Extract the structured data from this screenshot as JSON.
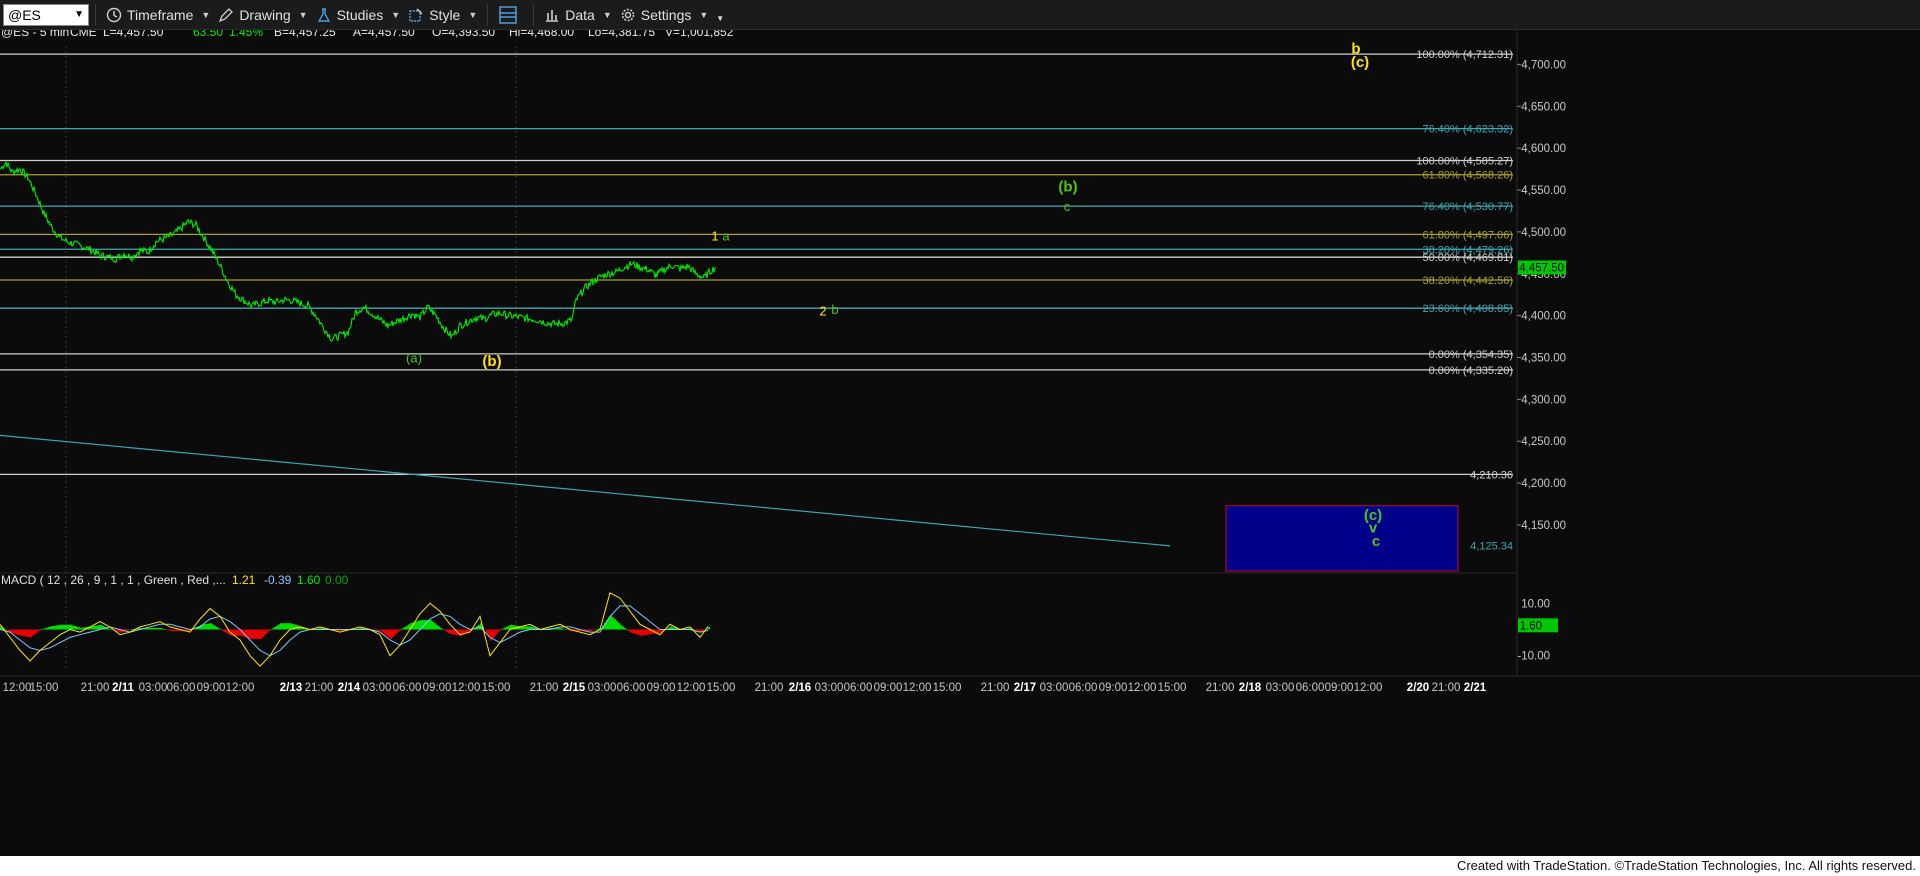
{
  "toolbar": {
    "symbol": "@ES",
    "timeframe": "Timeframe",
    "drawing": "Drawing",
    "studies": "Studies",
    "style": "Style",
    "data": "Data",
    "settings": "Settings"
  },
  "header": {
    "symbol_info": "@ES - 5 min",
    "exchange": "CME",
    "last": "L=4,457.50",
    "change": "63.50",
    "change_pct": "1.45%",
    "bid": "B=4,457.25",
    "ask": "A=4,457.50",
    "open": "O=4,393.50",
    "high": "Hi=4,468.00",
    "low": "Lo=4,381.75",
    "volume": "V=1,001,852"
  },
  "colors": {
    "price": "#00ee00",
    "bg": "#0b0b0b",
    "teal": "#3fa7b1",
    "olive": "#a8a02e",
    "white_line": "#d0d0d0",
    "yellow_label": "#ffe600",
    "green_label": "#4cc81a",
    "macd_up": "#00dd00",
    "macd_down": "#e60000",
    "box_fill": "#00008b",
    "box_border": "#cc0033"
  },
  "chart_data": {
    "type": "line",
    "title": "@ES - 5 min",
    "ylim": [
      4095,
      4722
    ],
    "price_axis_ticks": [
      "4,700.00",
      "4,650.00",
      "4,600.00",
      "4,550.00",
      "4,500.00",
      "4,450.00",
      "4,400.00",
      "4,350.00",
      "4,300.00",
      "4,250.00",
      "4,200.00",
      "4,150.00"
    ],
    "price_axis_values": [
      4700,
      4650,
      4600,
      4550,
      4500,
      4450,
      4400,
      4350,
      4300,
      4250,
      4200,
      4150
    ],
    "last_price_label": "4,457.50",
    "last_price": 4457.5,
    "time_axis": [
      "12:00",
      "15:00",
      "21:00",
      "2/11",
      "03:00",
      "06:00",
      "09:00",
      "12:00",
      "2/13",
      "21:00",
      "2/14",
      "03:00",
      "06:00",
      "09:00",
      "12:00",
      "15:00",
      "21:00",
      "2/15",
      "03:00",
      "06:00",
      "09:00",
      "12:00",
      "15:00",
      "21:00",
      "2/16",
      "03:00",
      "06:00",
      "09:00",
      "12:00",
      "15:00",
      "21:00",
      "2/17",
      "03:00",
      "06:00",
      "09:00",
      "12:00",
      "15:00",
      "21:00",
      "2/18",
      "03:00",
      "06:00",
      "09:00",
      "12:00",
      "2/20",
      "21:00",
      "2/21"
    ],
    "series": [
      {
        "name": "@ES",
        "points": [
          [
            0,
            4575
          ],
          [
            3,
            4583
          ],
          [
            6,
            4572
          ],
          [
            10,
            4575
          ],
          [
            14,
            4565
          ],
          [
            18,
            4545
          ],
          [
            22,
            4522
          ],
          [
            26,
            4505
          ],
          [
            30,
            4493
          ],
          [
            34,
            4488
          ],
          [
            38,
            4485
          ],
          [
            42,
            4482
          ],
          [
            46,
            4478
          ],
          [
            50,
            4472
          ],
          [
            54,
            4470
          ],
          [
            58,
            4468
          ],
          [
            62,
            4474
          ],
          [
            66,
            4470
          ],
          [
            70,
            4478
          ],
          [
            74,
            4476
          ],
          [
            78,
            4488
          ],
          [
            82,
            4492
          ],
          [
            86,
            4496
          ],
          [
            90,
            4503
          ],
          [
            94,
            4512
          ],
          [
            98,
            4508
          ],
          [
            102,
            4493
          ],
          [
            106,
            4478
          ],
          [
            110,
            4460
          ],
          [
            114,
            4440
          ],
          [
            118,
            4425
          ],
          [
            122,
            4418
          ],
          [
            126,
            4412
          ],
          [
            130,
            4415
          ],
          [
            134,
            4418
          ],
          [
            138,
            4416
          ],
          [
            142,
            4419
          ],
          [
            146,
            4418
          ],
          [
            150,
            4415
          ],
          [
            154,
            4412
          ],
          [
            158,
            4400
          ],
          [
            162,
            4385
          ],
          [
            166,
            4372
          ],
          [
            170,
            4376
          ],
          [
            174,
            4380
          ],
          [
            178,
            4405
          ],
          [
            182,
            4410
          ],
          [
            186,
            4403
          ],
          [
            190,
            4395
          ],
          [
            194,
            4388
          ],
          [
            198,
            4393
          ],
          [
            202,
            4397
          ],
          [
            206,
            4402
          ],
          [
            210,
            4398
          ],
          [
            214,
            4410
          ],
          [
            218,
            4400
          ],
          [
            222,
            4385
          ],
          [
            226,
            4375
          ],
          [
            230,
            4388
          ],
          [
            234,
            4393
          ],
          [
            238,
            4398
          ],
          [
            242,
            4396
          ],
          [
            246,
            4401
          ],
          [
            250,
            4403
          ],
          [
            254,
            4400
          ],
          [
            258,
            4399
          ],
          [
            262,
            4397
          ],
          [
            266,
            4396
          ],
          [
            270,
            4394
          ],
          [
            274,
            4391
          ],
          [
            278,
            4390
          ],
          [
            282,
            4391
          ],
          [
            286,
            4395
          ],
          [
            288,
            4418
          ],
          [
            292,
            4432
          ],
          [
            296,
            4440
          ],
          [
            300,
            4446
          ],
          [
            304,
            4450
          ],
          [
            308,
            4452
          ],
          [
            312,
            4458
          ],
          [
            316,
            4462
          ],
          [
            320,
            4458
          ],
          [
            324,
            4455
          ],
          [
            328,
            4448
          ],
          [
            332,
            4455
          ],
          [
            336,
            4460
          ],
          [
            340,
            4456
          ],
          [
            344,
            4459
          ],
          [
            348,
            4450
          ],
          [
            352,
            4445
          ],
          [
            356,
            4455
          ],
          [
            358,
            4457.5
          ]
        ]
      }
    ],
    "horizontal_levels": [
      {
        "label": "100.00% (4,712.31)",
        "value": 4712.31,
        "color": "#d0d0d0"
      },
      {
        "label": "76.40% (4,623.32)",
        "value": 4623.32,
        "color": "#3fa7b1"
      },
      {
        "label": "100.00% (4,585.27)",
        "value": 4585.27,
        "color": "#d0d0d0"
      },
      {
        "label": "61.80% (4,568.26)",
        "value": 4568.26,
        "color": "#a8a02e"
      },
      {
        "label": "76.40% (4,530.77)",
        "value": 4530.77,
        "color": "#3fa7b1"
      },
      {
        "label": "61.80% (4,497.06)",
        "value": 4497.06,
        "color": "#a8a02e"
      },
      {
        "label": "38.20% (4,479.26)",
        "value": 4479.26,
        "color": "#3fa7b1"
      },
      {
        "label": "50.00% (4,469.81)",
        "value": 4469.81,
        "color": "#d0d0d0"
      },
      {
        "label": "38.20% (4,442.56)",
        "value": 4442.56,
        "color": "#a8a02e"
      },
      {
        "label": "23.60% (4,408.85)",
        "value": 4408.85,
        "color": "#3fa7b1"
      },
      {
        "label": "0.00% (4,354.35)",
        "value": 4354.35,
        "color": "#d0d0d0"
      },
      {
        "label": "0.00% (4,335.20)",
        "value": 4335.2,
        "color": "#d0d0d0"
      },
      {
        "label": "4,210.36",
        "value": 4210.36,
        "color": "#d0d0d0"
      },
      {
        "label": "4,125.34",
        "value": 4125.34,
        "color": "#3fa7b1"
      }
    ],
    "trendline": {
      "from": [
        0,
        4257
      ],
      "to": [
        1170,
        4125
      ],
      "color": "#3fa7b1"
    },
    "annotations": [
      {
        "text": "b",
        "x": 1356,
        "value": 4713,
        "color": "#ffe600",
        "bold": true
      },
      {
        "text": "(c)",
        "x": 1360,
        "value": 4697,
        "color": "#ffe600",
        "bold": true
      },
      {
        "text": "(b)",
        "x": 1068,
        "value": 4548,
        "color": "#4cc81a",
        "bold": true
      },
      {
        "text": "c",
        "x": 1067,
        "value": 4525,
        "color": "#4cc81a",
        "bold": false
      },
      {
        "text": "1",
        "x": 715,
        "value": 4490,
        "color": "#ffe600",
        "bold": false
      },
      {
        "text": "a",
        "x": 726,
        "value": 4490,
        "color": "#4cc81a",
        "bold": false
      },
      {
        "text": "2",
        "x": 823,
        "value": 4400,
        "color": "#ffe600",
        "bold": false
      },
      {
        "text": "b",
        "x": 835,
        "value": 4402,
        "color": "#4cc81a",
        "bold": false
      },
      {
        "text": "(a)",
        "x": 414,
        "value": 4344,
        "color": "#4cc81a",
        "bold": false
      },
      {
        "text": "(b)",
        "x": 492,
        "value": 4340,
        "color": "#ffe600",
        "bold": true
      },
      {
        "text": "(c)",
        "x": 1373,
        "value": 4156,
        "color": "#4cc81a",
        "bold": true
      },
      {
        "text": "v",
        "x": 1373,
        "value": 4141,
        "color": "#4cc81a",
        "bold": true
      },
      {
        "text": "c",
        "x": 1376,
        "value": 4125,
        "color": "#4cc81a",
        "bold": true
      }
    ],
    "target_box": {
      "x1": 1226,
      "x2": 1458,
      "top": 4173,
      "bottom": 4095
    },
    "macd": {
      "label": "MACD ( 12 , 26 , 9 , 1 , 1 , Green , Red ,...",
      "macd_value": "1.21",
      "signal_value": "-0.39",
      "hist_value": "1.60",
      "zero_value": "0.00",
      "axis_ticks": [
        "10.00",
        "-10.00"
      ],
      "axis_values": [
        10,
        -10
      ],
      "current_label": "1.60",
      "current": 1.6,
      "ylim": [
        -17,
        17
      ],
      "macd_line": [
        [
          0,
          2
        ],
        [
          10,
          -3
        ],
        [
          20,
          -8
        ],
        [
          30,
          -12
        ],
        [
          40,
          -8
        ],
        [
          50,
          -5
        ],
        [
          60,
          -2
        ],
        [
          70,
          0
        ],
        [
          80,
          -1
        ],
        [
          90,
          1
        ],
        [
          100,
          3
        ],
        [
          110,
          1
        ],
        [
          120,
          -2
        ],
        [
          130,
          -1
        ],
        [
          140,
          1
        ],
        [
          150,
          2
        ],
        [
          160,
          3
        ],
        [
          170,
          1
        ],
        [
          180,
          0
        ],
        [
          190,
          -1
        ],
        [
          200,
          4
        ],
        [
          210,
          8
        ],
        [
          220,
          5
        ],
        [
          230,
          -1
        ],
        [
          240,
          -4
        ],
        [
          250,
          -10
        ],
        [
          260,
          -14
        ],
        [
          270,
          -10
        ],
        [
          280,
          -4
        ],
        [
          290,
          0
        ],
        [
          300,
          1
        ],
        [
          310,
          0
        ],
        [
          320,
          1
        ],
        [
          330,
          0
        ],
        [
          340,
          -1
        ],
        [
          350,
          0
        ],
        [
          360,
          1
        ],
        [
          370,
          0
        ],
        [
          380,
          -2
        ],
        [
          390,
          -10
        ],
        [
          400,
          -6
        ],
        [
          410,
          0
        ],
        [
          420,
          6
        ],
        [
          430,
          10
        ],
        [
          440,
          7
        ],
        [
          450,
          2
        ],
        [
          460,
          -2
        ],
        [
          470,
          -1
        ],
        [
          480,
          5
        ],
        [
          490,
          -10
        ],
        [
          500,
          -5
        ],
        [
          510,
          0
        ],
        [
          520,
          1
        ],
        [
          530,
          2
        ],
        [
          540,
          0
        ],
        [
          550,
          1
        ],
        [
          560,
          2
        ],
        [
          570,
          0
        ],
        [
          580,
          -1
        ],
        [
          590,
          -2
        ],
        [
          600,
          0
        ],
        [
          610,
          14
        ],
        [
          620,
          12
        ],
        [
          630,
          7
        ],
        [
          640,
          2
        ],
        [
          650,
          0
        ],
        [
          660,
          -2
        ],
        [
          670,
          2
        ],
        [
          680,
          0
        ],
        [
          690,
          1
        ],
        [
          700,
          -3
        ],
        [
          708,
          1.2
        ]
      ],
      "signal_line": [
        [
          0,
          0
        ],
        [
          10,
          -1
        ],
        [
          20,
          -4
        ],
        [
          30,
          -7
        ],
        [
          40,
          -8
        ],
        [
          50,
          -7
        ],
        [
          60,
          -5
        ],
        [
          70,
          -3
        ],
        [
          80,
          -2
        ],
        [
          90,
          -1
        ],
        [
          100,
          0
        ],
        [
          110,
          1
        ],
        [
          120,
          0
        ],
        [
          130,
          -1
        ],
        [
          140,
          0
        ],
        [
          150,
          1
        ],
        [
          160,
          2
        ],
        [
          170,
          2
        ],
        [
          180,
          1
        ],
        [
          190,
          0
        ],
        [
          200,
          1
        ],
        [
          210,
          4
        ],
        [
          220,
          5
        ],
        [
          230,
          3
        ],
        [
          240,
          0
        ],
        [
          250,
          -4
        ],
        [
          260,
          -8
        ],
        [
          270,
          -10
        ],
        [
          280,
          -8
        ],
        [
          290,
          -4
        ],
        [
          300,
          -1
        ],
        [
          310,
          0
        ],
        [
          320,
          0
        ],
        [
          330,
          0
        ],
        [
          340,
          0
        ],
        [
          350,
          0
        ],
        [
          360,
          0
        ],
        [
          370,
          0
        ],
        [
          380,
          -1
        ],
        [
          390,
          -4
        ],
        [
          400,
          -6
        ],
        [
          410,
          -4
        ],
        [
          420,
          0
        ],
        [
          430,
          4
        ],
        [
          440,
          6
        ],
        [
          450,
          5
        ],
        [
          460,
          2
        ],
        [
          470,
          0
        ],
        [
          480,
          1
        ],
        [
          490,
          -3
        ],
        [
          500,
          -5
        ],
        [
          510,
          -3
        ],
        [
          520,
          -1
        ],
        [
          530,
          0
        ],
        [
          540,
          0
        ],
        [
          550,
          0
        ],
        [
          560,
          1
        ],
        [
          570,
          1
        ],
        [
          580,
          0
        ],
        [
          590,
          -1
        ],
        [
          600,
          -1
        ],
        [
          610,
          5
        ],
        [
          620,
          9
        ],
        [
          630,
          9
        ],
        [
          640,
          6
        ],
        [
          650,
          3
        ],
        [
          660,
          0
        ],
        [
          670,
          0
        ],
        [
          680,
          0
        ],
        [
          690,
          0
        ],
        [
          700,
          -1
        ],
        [
          708,
          -0.39
        ]
      ]
    }
  },
  "footer": {
    "credit": "Created with TradeStation. ©TradeStation Technologies, Inc. All rights reserved."
  }
}
